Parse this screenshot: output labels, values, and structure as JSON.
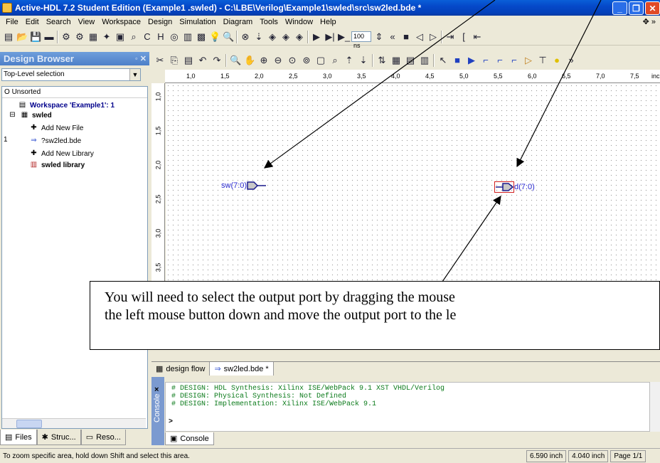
{
  "window": {
    "title": "Active-HDL 7.2 Student Edition (Example1 .swled) - C:\\LBE\\Verilog\\Example1\\swled\\src\\sw2led.bde *"
  },
  "menu": {
    "items": [
      "File",
      "Edit",
      "Search",
      "View",
      "Workspace",
      "Design",
      "Simulation",
      "Diagram",
      "Tools",
      "Window",
      "Help"
    ]
  },
  "toolbar": {
    "sim_time": "100 ns"
  },
  "design_browser": {
    "title": "Design Browser",
    "selection": "Top-Level selection",
    "tree_header": "Unsorted",
    "tree": {
      "workspace": "Workspace 'Example1': 1",
      "design": "swled",
      "add_file": "Add New File",
      "file_num": "1",
      "file": "sw2led.bde",
      "add_library": "Add New Library",
      "library": "swled library"
    },
    "tabs": [
      "Files",
      "Struc...",
      "Reso..."
    ]
  },
  "ruler": {
    "top": [
      "1,0",
      "1,5",
      "2,0",
      "2,5",
      "3,0",
      "3,5",
      "4,0",
      "4,5",
      "5,0",
      "5,5",
      "6,0",
      "6,5",
      "7,0",
      "7,5",
      "inch"
    ],
    "left": [
      "1,0",
      "1,5",
      "2,0",
      "2,5",
      "3,0",
      "3,5"
    ]
  },
  "diagram": {
    "input_port": "sw(7:0)",
    "output_port": "d(7:0)"
  },
  "callout": {
    "line1": "You will need to select the output port by dragging the mouse",
    "line2": "the left mouse button down and move the output port to the le"
  },
  "doc_tabs": [
    "design flow",
    "sw2led.bde *"
  ],
  "console": {
    "side_label": "Console",
    "lines": [
      "# DESIGN: HDL Synthesis: Xilinx ISE/WebPack 9.1 XST VHDL/Verilog",
      "# DESIGN: Physical Synthesis: Not Defined",
      "# DESIGN: Implementation: Xilinx ISE/WebPack 9.1"
    ],
    "prompt": ">",
    "tab": "Console"
  },
  "status": {
    "message": "To zoom specific area, hold down Shift and select this area.",
    "x": "6.590 inch",
    "y": "4.040 inch",
    "page": "Page 1/1"
  }
}
